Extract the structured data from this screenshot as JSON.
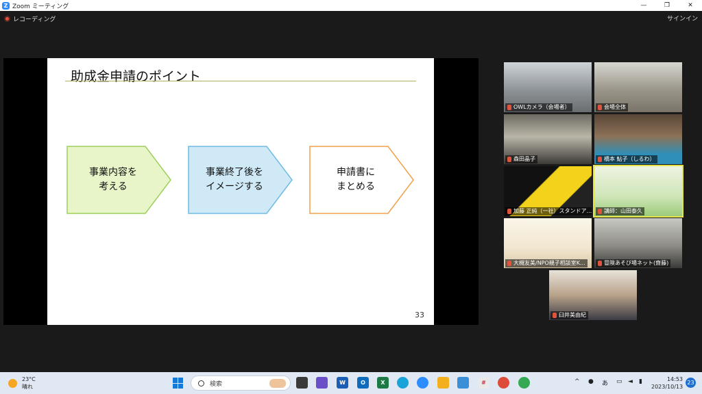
{
  "window": {
    "title": "Zoom ミーティング",
    "logo": "Z"
  },
  "zoom_bar": {
    "recording_label": "レコーディング",
    "signin_label": "サインイン"
  },
  "slide": {
    "title": "助成金申請のポイント",
    "steps": [
      {
        "line1": "事業内容を",
        "line2": "考える",
        "fill": "#e8f5c8",
        "stroke": "#9ccf5c"
      },
      {
        "line1": "事業終了後を",
        "line2": "イメージする",
        "fill": "#cfe9f7",
        "stroke": "#6fbbe3"
      },
      {
        "line1": "申請書に",
        "line2": "まとめる",
        "fill": "#ffffff",
        "stroke": "#f0a04b"
      }
    ],
    "page_number": "33"
  },
  "participants": [
    {
      "name": "OWLカメラ（会場者）"
    },
    {
      "name": "会場全体"
    },
    {
      "name": "森田晶子"
    },
    {
      "name": "橋本 鮎子（しるわ）"
    },
    {
      "name": "加藤 正純（一社）スタンドア..."
    },
    {
      "name": "講師：山田泰久"
    },
    {
      "name": "大槻友美/NPO親子相談室K..."
    },
    {
      "name": "冒険あそび場ネット(齋藤)"
    },
    {
      "name": "臼井美由紀"
    }
  ],
  "taskbar": {
    "weather_temp": "23°C",
    "weather_desc": "晴れ",
    "search_placeholder": "検索",
    "ime": "あ",
    "time": "14:53",
    "date": "2023/10/13",
    "notifications": "23"
  }
}
